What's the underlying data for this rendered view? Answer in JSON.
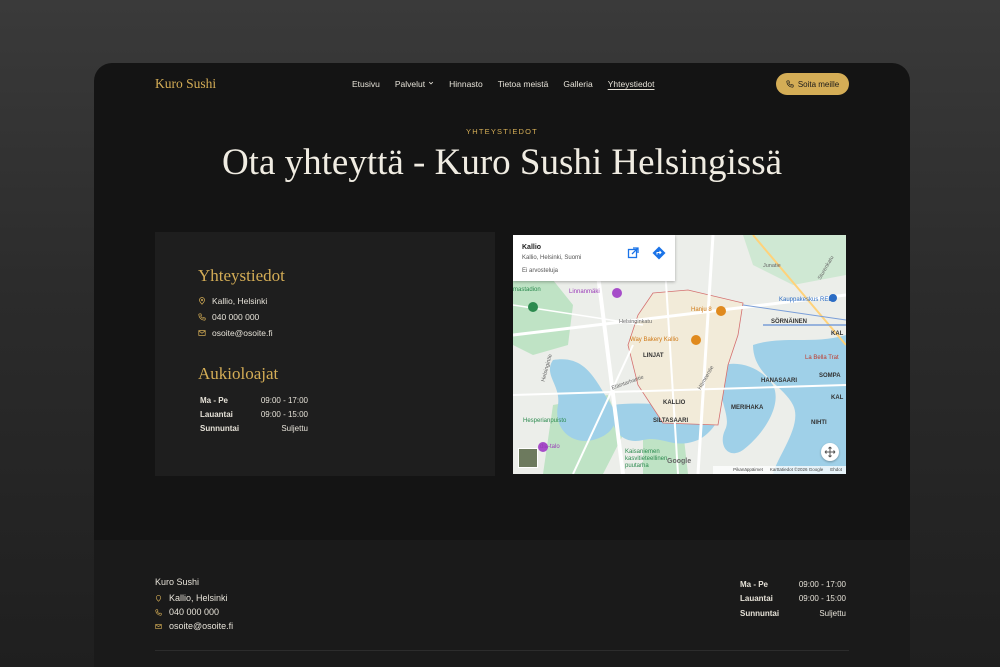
{
  "header": {
    "logo": "Kuro Sushi",
    "nav": [
      "Etusivu",
      "Palvelut",
      "Hinnasto",
      "Tietoa meistä",
      "Galleria",
      "Yhteystiedot"
    ],
    "active_nav": "Yhteystiedot",
    "call_button": "Soita meille"
  },
  "hero": {
    "eyebrow": "YHTEYSTIEDOT",
    "title": "Ota yhteyttä - Kuro Sushi Helsingissä"
  },
  "contact": {
    "heading": "Yhteystiedot",
    "address": "Kallio, Helsinki",
    "phone": "040 000 000",
    "email": "osoite@osoite.fi",
    "hours_heading": "Aukioloajat",
    "hours": [
      {
        "day": "Ma - Pe",
        "time": "09:00 - 17:00"
      },
      {
        "day": "Lauantai",
        "time": "09:00 - 15:00"
      },
      {
        "day": "Sunnuntai",
        "time": "Suljettu"
      }
    ]
  },
  "map": {
    "place_name": "Kallio",
    "place_address": "Kallio, Helsinki, Suomi",
    "reviews": "Ei arvosteluja",
    "labels": {
      "linnanmaki": "Linnanmäki",
      "hanju": "Hanju 8",
      "bakery": "Way Bakery Kallio",
      "linjat": "LINJAT",
      "kallio": "KALLIO",
      "siltasaari": "SILTASAARI",
      "merihaka": "MERIHAKA",
      "hanasaari": "HANASAARI",
      "sornainen": "SÖRNÄINEN",
      "sompa": "SOMPA",
      "niitti": "NIHTI",
      "kauppakeskus": "Kauppakeskus REDI",
      "labella": "La Bella Trat",
      "hesperianpuisto": "Hesperianpuisto",
      "stadion": "mastadion",
      "talo": "dia-talo",
      "kaisaniemi": "Kaisaniemen kasvitieteellinen puutarha",
      "helsinginkatu": "Helsinginkatu",
      "hameentie": "Hämeentie",
      "elaintarhantie": "Eläintarhantie",
      "helsinginkatu2": "Helsingintie",
      "sturenkatu": "Sturenkatu",
      "jumalla": "Junatie",
      "kalasatama": "KAL",
      "kala2": "KAL"
    },
    "google": "Google",
    "footer": [
      "Pikanäppäimet",
      "Karttatiedot ©2026 Google",
      "Ehdot"
    ]
  },
  "footer": {
    "brand": "Kuro Sushi",
    "address": "Kallio, Helsinki",
    "phone": "040 000 000",
    "email": "osoite@osoite.fi",
    "hours": [
      {
        "day": "Ma - Pe",
        "time": "09:00 - 17:00"
      },
      {
        "day": "Lauantai",
        "time": "09:00 - 15:00"
      },
      {
        "day": "Sunnuntai",
        "time": "Suljettu"
      }
    ]
  },
  "colors": {
    "accent": "#d4ad56",
    "background": "#141414",
    "card": "#1e1e1e"
  },
  "icons": [
    "pin-icon",
    "phone-icon",
    "mail-icon",
    "chevron-down-icon",
    "external-link-icon",
    "directions-icon",
    "fullscreen-icon"
  ]
}
